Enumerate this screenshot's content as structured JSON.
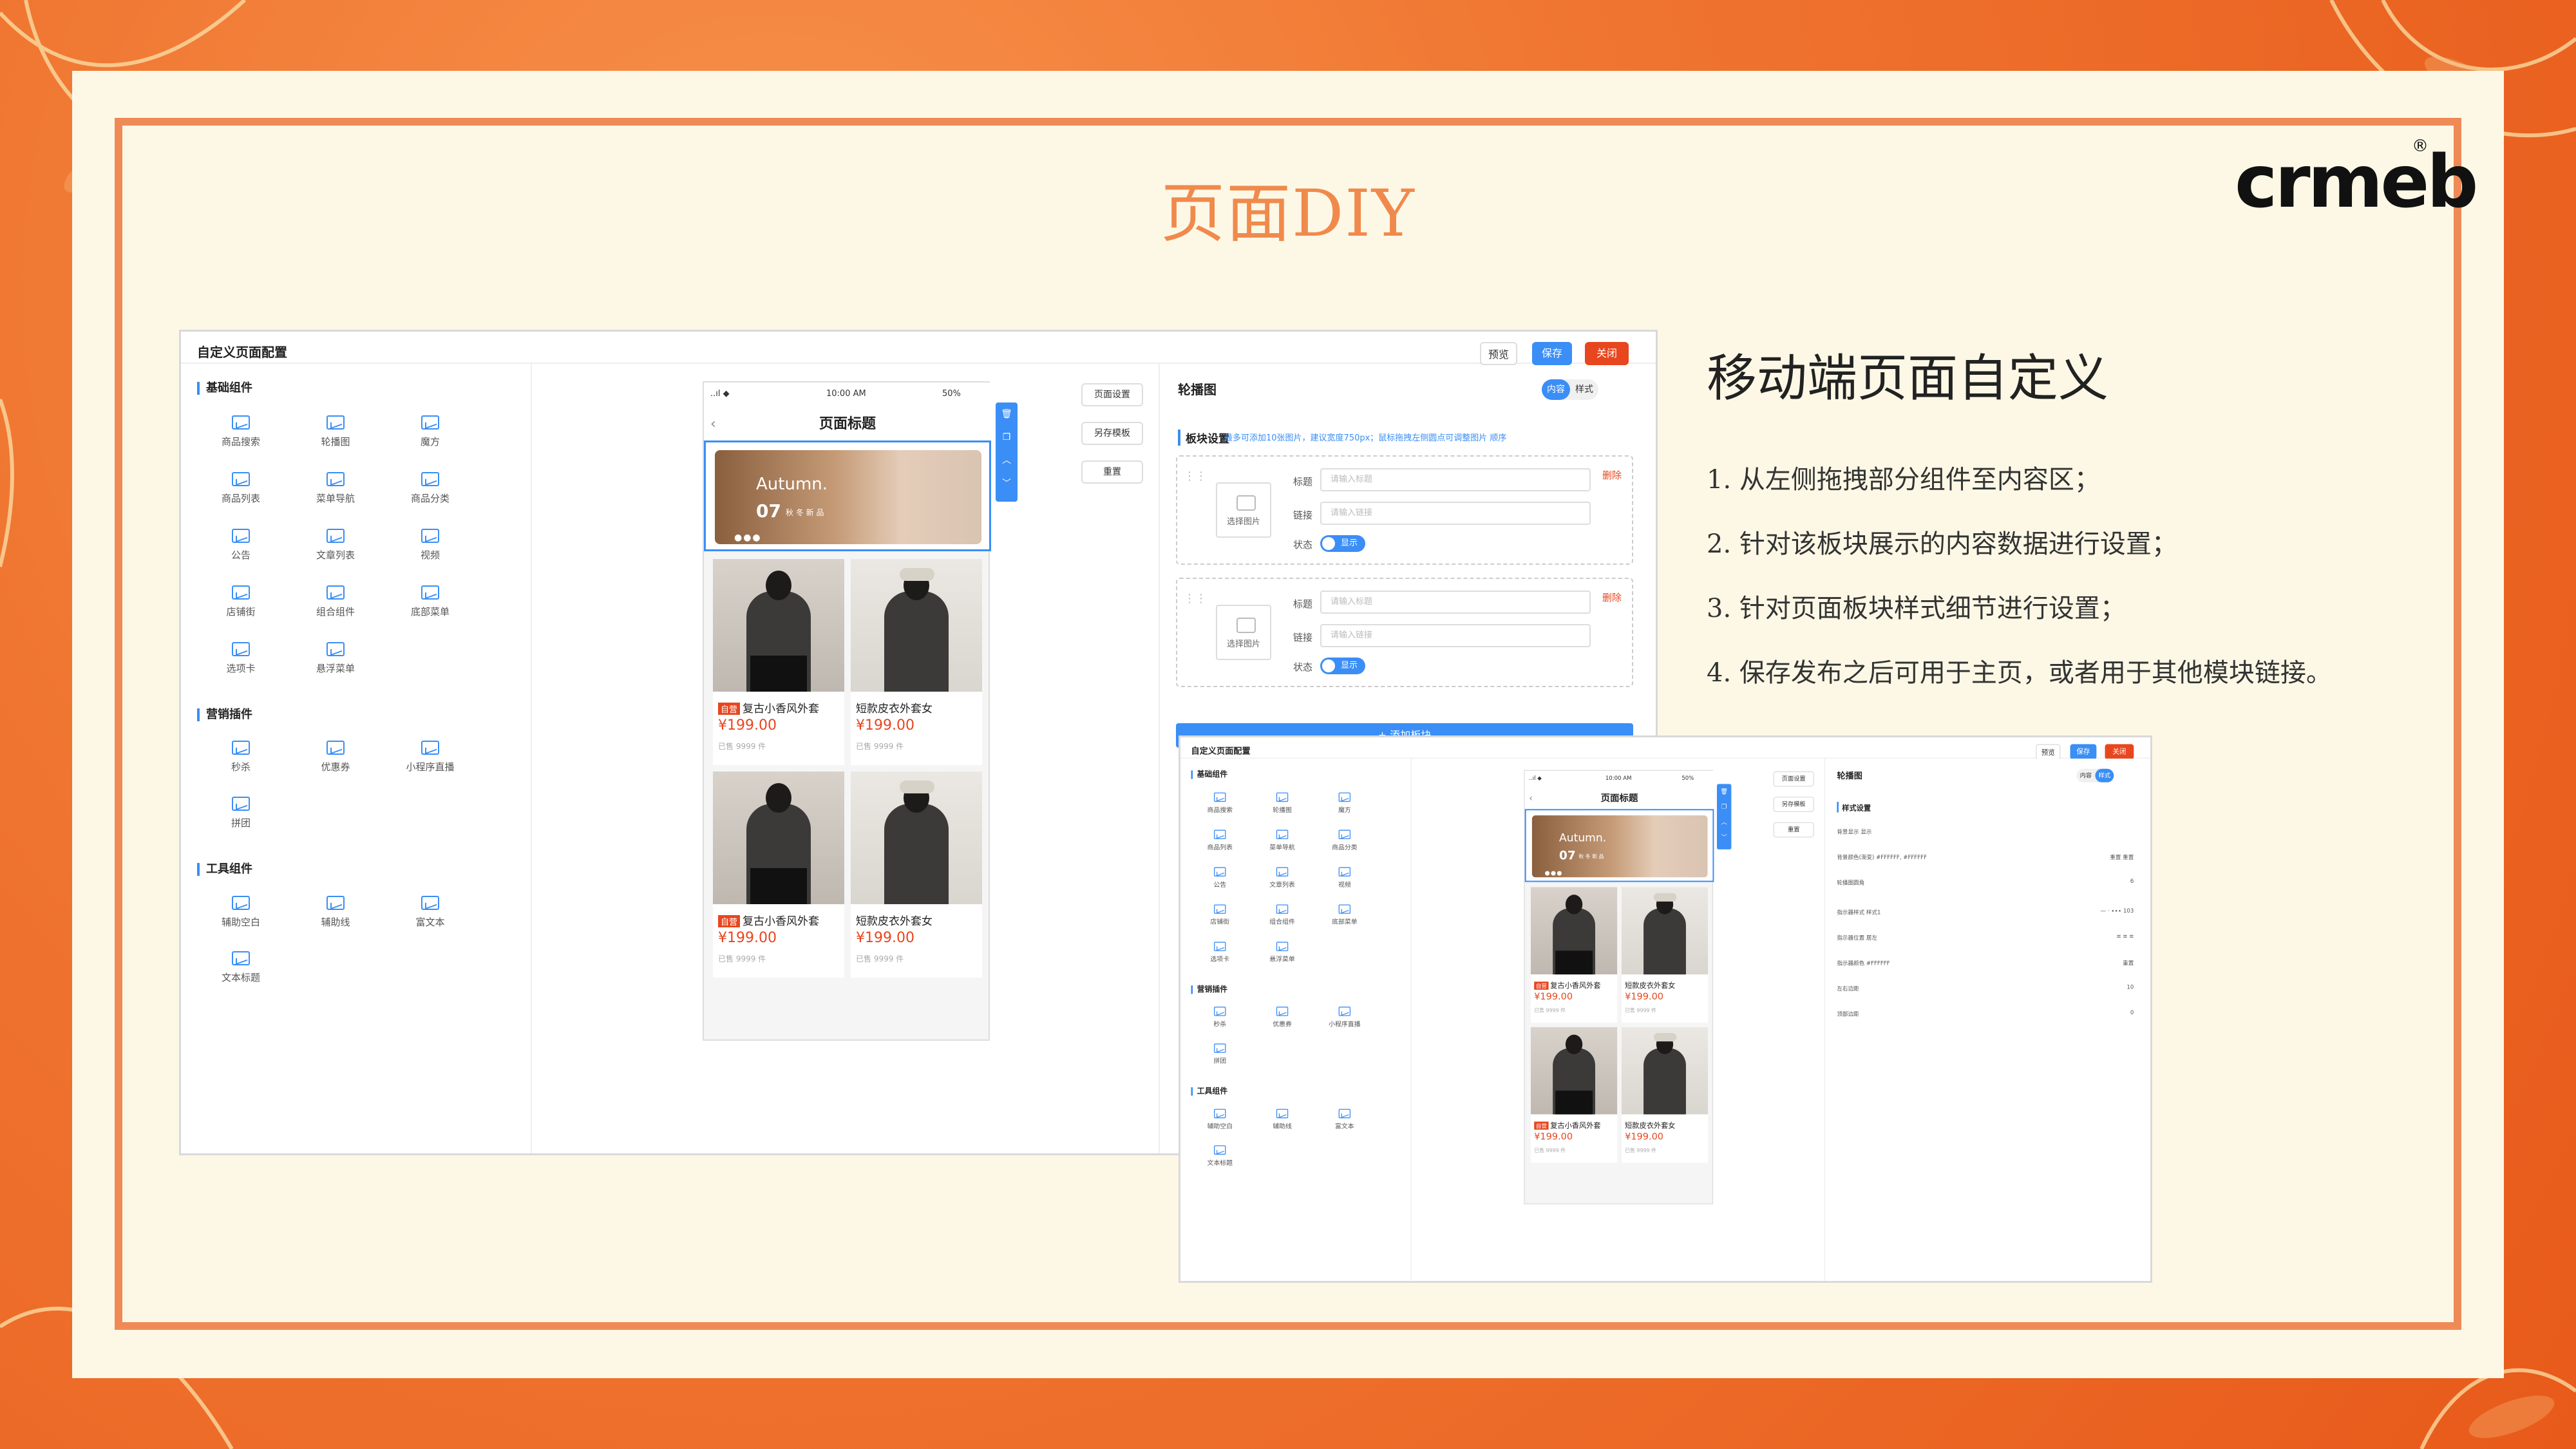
{
  "slide": {
    "title": "页面DIY",
    "logo": "crmeb",
    "logo_mark": "®",
    "heading": "移动端页面自定义",
    "steps": [
      "1.  从左侧拖拽部分组件至内容区；",
      "2.  针对该板块展示的内容数据进行设置；",
      "3.  针对页面板块样式细节进行设置；",
      "4.  保存发布之后可用于主页，或者用于其他模块链接。"
    ]
  },
  "app": {
    "title": "自定义页面配置",
    "buttons": {
      "preview": "预览",
      "save": "保存",
      "close": "关闭"
    },
    "sections": {
      "basic": {
        "label": "基础组件",
        "items": [
          "商品搜索",
          "轮播图",
          "魔方",
          "商品列表",
          "菜单导航",
          "商品分类",
          "公告",
          "文章列表",
          "视频",
          "店铺街",
          "组合组件",
          "底部菜单",
          "选项卡",
          "悬浮菜单"
        ]
      },
      "marketing": {
        "label": "营销插件",
        "items": [
          "秒杀",
          "优惠券",
          "小程序直播",
          "拼团"
        ]
      },
      "tools": {
        "label": "工具组件",
        "items": [
          "辅助空白",
          "辅助线",
          "富文本",
          "文本标题"
        ]
      }
    },
    "phone": {
      "time": "10:00 AM",
      "battery": "50%",
      "signal": "..ıl ◆",
      "back": "‹",
      "nav_title": "页面标题",
      "banner": {
        "title": "Autumn.",
        "day": "07",
        "sub": "秋 冬 新 品",
        "dots": "●●●"
      },
      "products": [
        {
          "tag": "自营",
          "name": "复古小香风外套",
          "price": "¥199.00",
          "sold": "已售 9999 件"
        },
        {
          "tag": "",
          "name": "短款皮衣外套女",
          "price": "¥199.00",
          "sold": "已售 9999 件"
        },
        {
          "tag": "自营",
          "name": "复古小香风外套",
          "price": "¥199.00",
          "sold": "已售 9999 件"
        },
        {
          "tag": "",
          "name": "短款皮衣外套女",
          "price": "¥199.00",
          "sold": "已售 9999 件"
        }
      ]
    },
    "tools_strip": [
      "🗑",
      "❐",
      "︿",
      "﹀"
    ],
    "page_buttons": [
      "页面设置",
      "另存模板",
      "重置"
    ],
    "right": {
      "title": "轮播图",
      "tab_content": "内容",
      "tab_style": "样式",
      "block_label": "板块设置",
      "hint": "最多可添加10张图片，建议宽度750px；鼠标拖拽左侧圆点可调整图片 顺序",
      "pick_image": "选择图片",
      "title_label": "标题",
      "title_placeholder": "请输入标题",
      "link_label": "链接",
      "link_placeholder": "请输入链接",
      "status_label": "状态",
      "status_value": "显示",
      "delete": "删除",
      "drag_handle": "⋮⋮",
      "add_button": "+ 添加板块"
    },
    "style_panel": {
      "block_label": "样式设置",
      "rows": [
        {
          "label": "背景显示  显示",
          "value": ""
        },
        {
          "label": "背景颜色(渐变) #FFFFFF, #FFFFFF",
          "value": "重置   重置"
        },
        {
          "label": "轮播图圆角",
          "value": "6"
        },
        {
          "label": "指示器样式  样式1",
          "value": "— · ∙∙∙  103"
        },
        {
          "label": "指示器位置  居左",
          "value": "≡ ≡ ≡"
        },
        {
          "label": "指示器颜色 #FFFFFF",
          "value": "重置"
        },
        {
          "label": "左右边距",
          "value": "10"
        },
        {
          "label": "顶部边距",
          "value": "0"
        }
      ]
    }
  }
}
